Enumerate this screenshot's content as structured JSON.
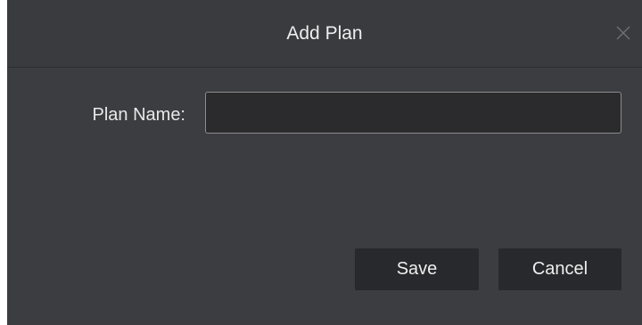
{
  "dialog": {
    "title": "Add Plan",
    "close_icon": "close-icon"
  },
  "form": {
    "plan_name_label": "Plan Name:",
    "plan_name_value": "",
    "plan_name_placeholder": ""
  },
  "actions": {
    "save_label": "Save",
    "cancel_label": "Cancel"
  },
  "colors": {
    "dialog_background": "#3c3d41",
    "button_background": "#28292c",
    "input_background": "#2b2b2e",
    "text": "#eeeeee"
  }
}
